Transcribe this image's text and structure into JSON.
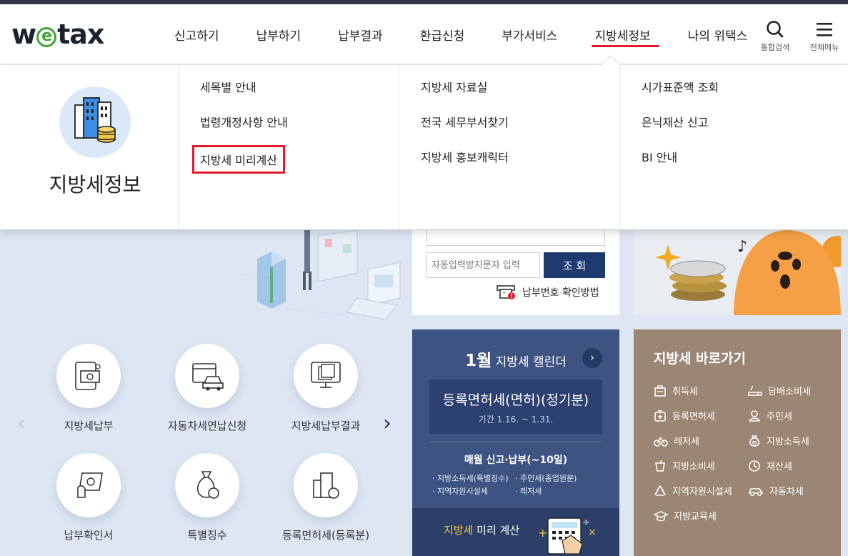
{
  "header": {
    "logo": {
      "w": "w",
      "e": "e",
      "rest": "tax"
    },
    "nav": [
      {
        "label": "신고하기",
        "active": false
      },
      {
        "label": "납부하기",
        "active": false
      },
      {
        "label": "납부결과",
        "active": false
      },
      {
        "label": "환급신청",
        "active": false
      },
      {
        "label": "부가서비스",
        "active": false
      },
      {
        "label": "지방세정보",
        "active": true
      },
      {
        "label": "나의 위택스",
        "active": false
      }
    ],
    "search_label": "통합검색",
    "menu_label": "전체메뉴",
    "accent_color": "#e21b2b"
  },
  "mega_menu": {
    "title": "지방세정보",
    "columns": [
      [
        "세목별 안내",
        "법령개정사항 안내",
        "지방세 미리계산"
      ],
      [
        "지방세 자료실",
        "전국 세무부서찾기",
        "지방세 홍보캐릭터"
      ],
      [
        "시가표준액 조회",
        "은닉재산 신고",
        "BI 안내"
      ]
    ],
    "highlighted": "지방세 미리계산"
  },
  "login": {
    "captcha_placeholder": "자동입력방지문자 입력",
    "query_button": "조 회",
    "pay_help": "납부번호 확인방법"
  },
  "services": [
    {
      "label": "지방세납부",
      "icon": "tax-payment-icon"
    },
    {
      "label": "자동차세연납신청",
      "icon": "car-tax-icon"
    },
    {
      "label": "지방세납부결과",
      "icon": "payment-result-icon"
    },
    {
      "label": "납부확인서",
      "icon": "payment-certificate-icon"
    },
    {
      "label": "특별징수",
      "icon": "special-collection-icon"
    },
    {
      "label": "등록면허세(등록분)",
      "icon": "registration-tax-icon"
    }
  ],
  "calendar": {
    "month": "1월",
    "title": "지방세 캘린더",
    "card_title": "등록면허세(면허)(정기분)",
    "card_period": "기간 1.16. ~ 1.31.",
    "monthly": "매월 신고·납부(~10일)",
    "items": [
      "· 지방소득세(특별징수)",
      "· 주민세(종업원분)",
      "· 지역자원시설세",
      "· 레저세"
    ],
    "bottom_highlight": "지방세",
    "bottom_rest": " 미리 계산"
  },
  "shortcuts": {
    "title": "지방세 바로가기",
    "items": [
      {
        "label": "취득세",
        "icon": "acquisition-tax-icon"
      },
      {
        "label": "담배소비세",
        "icon": "tobacco-tax-icon"
      },
      {
        "label": "등록면허세",
        "icon": "registration-license-tax-icon"
      },
      {
        "label": "주민세",
        "icon": "resident-tax-icon"
      },
      {
        "label": "레저세",
        "icon": "leisure-tax-icon"
      },
      {
        "label": "지방소득세",
        "icon": "local-income-tax-icon"
      },
      {
        "label": "지방소비세",
        "icon": "local-consumption-tax-icon"
      },
      {
        "label": "재산세",
        "icon": "property-tax-icon"
      },
      {
        "label": "지역자원시설세",
        "icon": "regional-resource-tax-icon"
      },
      {
        "label": "자동차세",
        "icon": "vehicle-tax-icon"
      },
      {
        "label": "지방교육세",
        "icon": "local-education-tax-icon"
      }
    ]
  }
}
